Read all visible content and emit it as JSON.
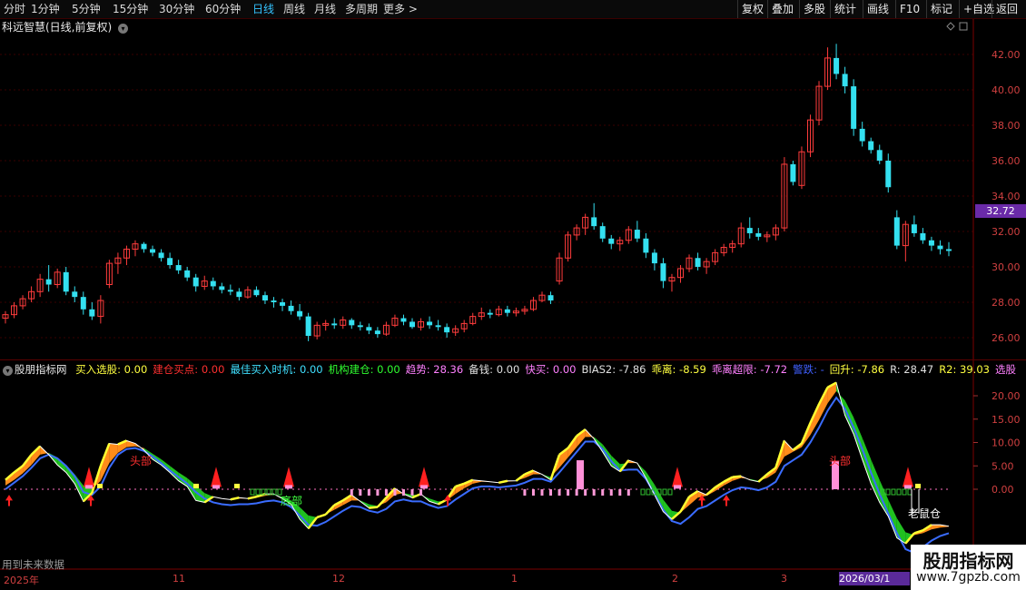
{
  "toolbar": {
    "periods": [
      "分时",
      "1分钟",
      "5分钟",
      "15分钟",
      "30分钟",
      "60分钟",
      "日线",
      "周线",
      "月线",
      "多周期",
      "更多 >"
    ],
    "active_period": "日线",
    "right_buttons": [
      "复权",
      "叠加",
      "多股",
      "统计",
      "画线",
      "F10",
      "标记",
      "+自选",
      "返回"
    ]
  },
  "chart_title": "科远智慧(日线,前复权)",
  "price_axis": {
    "ticks": [
      "42.00",
      "40.00",
      "38.00",
      "36.00",
      "34.00",
      "32.00",
      "30.00",
      "28.00",
      "26.00"
    ],
    "current": "32.72"
  },
  "indicator": {
    "name": "股朋指标网",
    "items": [
      {
        "label": "买入选股: 0.00",
        "color": "#ffff40"
      },
      {
        "label": "建仓买点: 0.00",
        "color": "#ff3030"
      },
      {
        "label": "最佳买入时机: 0.00",
        "color": "#40e0ff"
      },
      {
        "label": "机构建仓: 0.00",
        "color": "#30ff30"
      },
      {
        "label": "趋势: 28.36",
        "color": "#ff80ff"
      },
      {
        "label": "备钱: 0.00",
        "color": "#e0e0e0"
      },
      {
        "label": "快买: 0.00",
        "color": "#ff80ff"
      },
      {
        "label": "BIAS2: -7.86",
        "color": "#e0e0e0"
      },
      {
        "label": "乖离: -8.59",
        "color": "#ffff40"
      },
      {
        "label": "乖离超限: -7.72",
        "color": "#ff80ff"
      },
      {
        "label": "警跌: -",
        "color": "#4060ff"
      },
      {
        "label": "回升: -7.86",
        "color": "#ffff40"
      },
      {
        "label": "R: 28.47",
        "color": "#e0e0e0"
      },
      {
        "label": "R2: 39.03",
        "color": "#ffff40"
      },
      {
        "label": "选股",
        "color": "#ff80ff"
      }
    ],
    "axis": [
      "20.00",
      "15.00",
      "10.00",
      "5.00",
      "0.00"
    ],
    "labels": {
      "bottom": "底部",
      "top": "头部",
      "exit": "老鼠仓"
    }
  },
  "footer_note": "用到未来数据",
  "x_axis": [
    "2025年",
    "11",
    "12",
    "1",
    "2",
    "3"
  ],
  "cursor_date": "2026/03/1",
  "watermark": {
    "line1": "股朋指标网",
    "line2": "www.7gpzb.com"
  },
  "candles": [
    [
      27.1,
      27.5,
      26.8,
      27.3
    ],
    [
      27.3,
      28.0,
      27.1,
      27.8
    ],
    [
      27.8,
      28.4,
      27.6,
      28.2
    ],
    [
      28.2,
      28.9,
      28.0,
      28.6
    ],
    [
      28.6,
      29.6,
      28.3,
      29.3
    ],
    [
      29.3,
      30.1,
      28.6,
      29.0
    ],
    [
      29.0,
      29.9,
      28.8,
      29.7
    ],
    [
      29.7,
      30.0,
      28.4,
      28.6
    ],
    [
      28.6,
      28.9,
      28.0,
      28.3
    ],
    [
      28.3,
      28.6,
      27.3,
      27.6
    ],
    [
      27.6,
      28.0,
      27.0,
      27.2
    ],
    [
      27.2,
      28.4,
      26.8,
      28.1
    ],
    [
      29.0,
      30.4,
      28.8,
      30.2
    ],
    [
      30.2,
      30.8,
      29.6,
      30.5
    ],
    [
      30.5,
      31.2,
      30.1,
      31.0
    ],
    [
      31.0,
      31.5,
      30.6,
      31.3
    ],
    [
      31.3,
      31.4,
      30.8,
      31.0
    ],
    [
      31.0,
      31.2,
      30.6,
      30.8
    ],
    [
      30.8,
      31.0,
      30.3,
      30.5
    ],
    [
      30.5,
      30.8,
      29.9,
      30.1
    ],
    [
      30.1,
      30.4,
      29.6,
      29.8
    ],
    [
      29.8,
      30.0,
      29.2,
      29.4
    ],
    [
      29.4,
      29.6,
      28.6,
      28.9
    ],
    [
      28.9,
      29.5,
      28.7,
      29.2
    ],
    [
      29.2,
      29.4,
      28.7,
      28.9
    ],
    [
      28.9,
      29.1,
      28.5,
      28.7
    ],
    [
      28.7,
      29.0,
      28.4,
      28.6
    ],
    [
      28.6,
      28.8,
      28.1,
      28.3
    ],
    [
      28.3,
      28.9,
      28.2,
      28.7
    ],
    [
      28.7,
      28.9,
      28.3,
      28.4
    ],
    [
      28.4,
      28.6,
      27.9,
      28.1
    ],
    [
      28.1,
      28.3,
      27.7,
      28.0
    ],
    [
      28.0,
      28.2,
      27.5,
      27.8
    ],
    [
      27.8,
      28.1,
      27.3,
      27.5
    ],
    [
      27.5,
      27.9,
      27.0,
      27.2
    ],
    [
      27.2,
      27.4,
      25.8,
      26.1
    ],
    [
      26.1,
      26.9,
      25.9,
      26.7
    ],
    [
      26.7,
      27.0,
      26.4,
      26.8
    ],
    [
      26.8,
      27.1,
      26.5,
      26.7
    ],
    [
      26.7,
      27.2,
      26.5,
      27.0
    ],
    [
      27.0,
      27.1,
      26.5,
      26.7
    ],
    [
      26.7,
      26.9,
      26.4,
      26.6
    ],
    [
      26.6,
      26.8,
      26.2,
      26.4
    ],
    [
      26.4,
      26.6,
      26.0,
      26.2
    ],
    [
      26.2,
      26.9,
      26.1,
      26.7
    ],
    [
      26.7,
      27.3,
      26.6,
      27.1
    ],
    [
      27.1,
      27.3,
      26.7,
      26.9
    ],
    [
      26.9,
      27.1,
      26.5,
      26.6
    ],
    [
      26.6,
      27.1,
      26.4,
      26.9
    ],
    [
      26.9,
      27.2,
      26.5,
      26.7
    ],
    [
      26.7,
      27.0,
      26.4,
      26.6
    ],
    [
      26.6,
      26.8,
      26.0,
      26.3
    ],
    [
      26.3,
      26.7,
      26.1,
      26.5
    ],
    [
      26.5,
      27.0,
      26.3,
      26.8
    ],
    [
      26.8,
      27.4,
      26.7,
      27.2
    ],
    [
      27.2,
      27.7,
      27.0,
      27.4
    ],
    [
      27.4,
      27.6,
      27.1,
      27.3
    ],
    [
      27.3,
      27.8,
      27.2,
      27.6
    ],
    [
      27.6,
      27.8,
      27.2,
      27.4
    ],
    [
      27.4,
      27.7,
      27.2,
      27.5
    ],
    [
      27.5,
      27.8,
      27.3,
      27.6
    ],
    [
      27.6,
      28.3,
      27.5,
      28.1
    ],
    [
      28.1,
      28.6,
      28.0,
      28.4
    ],
    [
      28.4,
      28.6,
      27.9,
      28.1
    ],
    [
      29.2,
      30.8,
      29.0,
      30.5
    ],
    [
      30.5,
      32.0,
      30.3,
      31.8
    ],
    [
      31.8,
      32.4,
      31.5,
      32.2
    ],
    [
      32.2,
      33.0,
      31.8,
      32.8
    ],
    [
      32.8,
      33.6,
      32.1,
      32.3
    ],
    [
      32.3,
      32.5,
      31.4,
      31.6
    ],
    [
      31.6,
      31.8,
      31.0,
      31.3
    ],
    [
      31.3,
      31.7,
      30.9,
      31.5
    ],
    [
      31.5,
      32.3,
      31.3,
      32.1
    ],
    [
      32.1,
      32.6,
      31.4,
      31.6
    ],
    [
      31.6,
      31.9,
      30.5,
      30.8
    ],
    [
      30.8,
      31.0,
      29.8,
      30.2
    ],
    [
      30.2,
      30.5,
      28.8,
      29.2
    ],
    [
      29.2,
      29.6,
      28.6,
      29.4
    ],
    [
      29.4,
      30.1,
      29.1,
      29.9
    ],
    [
      29.9,
      30.7,
      29.7,
      30.5
    ],
    [
      30.5,
      30.8,
      29.8,
      30.0
    ],
    [
      30.0,
      30.5,
      29.6,
      30.3
    ],
    [
      30.3,
      31.0,
      30.1,
      30.8
    ],
    [
      30.8,
      31.3,
      30.6,
      31.1
    ],
    [
      31.1,
      31.5,
      30.8,
      31.3
    ],
    [
      31.3,
      32.5,
      31.1,
      32.2
    ],
    [
      32.2,
      32.8,
      31.6,
      31.9
    ],
    [
      31.9,
      32.2,
      31.5,
      31.7
    ],
    [
      31.7,
      32.0,
      31.4,
      31.8
    ],
    [
      31.8,
      32.4,
      31.5,
      32.2
    ],
    [
      32.2,
      36.2,
      32.0,
      35.8
    ],
    [
      35.8,
      36.0,
      34.6,
      34.8
    ],
    [
      34.6,
      36.8,
      34.4,
      36.5
    ],
    [
      36.5,
      38.6,
      36.2,
      38.3
    ],
    [
      38.3,
      40.5,
      38.0,
      40.2
    ],
    [
      40.2,
      42.4,
      40.0,
      41.8
    ],
    [
      41.8,
      42.6,
      40.6,
      40.9
    ],
    [
      40.9,
      41.3,
      39.8,
      40.2
    ],
    [
      40.2,
      40.6,
      37.4,
      37.8
    ],
    [
      37.8,
      38.2,
      36.8,
      37.1
    ],
    [
      37.1,
      37.3,
      36.4,
      36.6
    ],
    [
      36.6,
      36.9,
      35.8,
      36.0
    ],
    [
      36.0,
      36.4,
      34.2,
      34.5
    ],
    [
      32.8,
      33.2,
      31.0,
      31.2
    ],
    [
      31.2,
      32.6,
      30.3,
      32.4
    ],
    [
      32.4,
      32.9,
      31.7,
      31.9
    ],
    [
      31.9,
      32.2,
      31.3,
      31.5
    ],
    [
      31.5,
      31.7,
      30.9,
      31.2
    ],
    [
      31.2,
      31.5,
      30.7,
      31.0
    ],
    [
      31.0,
      31.4,
      30.6,
      30.9
    ]
  ],
  "indicator_series": {
    "main": [
      2,
      3.6,
      5,
      7.4,
      9.2,
      7.4,
      5.2,
      3.6,
      1.2,
      -2.6,
      -0.8,
      5,
      9.8,
      9.6,
      10.4,
      9.8,
      8.4,
      6.4,
      5.2,
      3.6,
      1.8,
      0.6,
      -2.4,
      -2.8,
      -1.6,
      -2,
      -2.2,
      -1.8,
      -2,
      -1.6,
      -1,
      -1,
      -2,
      -3.2,
      -6.4,
      -8.4,
      -6,
      -5.4,
      -3.4,
      -2.4,
      -1.2,
      -2.6,
      -4,
      -3.8,
      -1.8,
      0.2,
      -1,
      -1.8,
      -1,
      -2.6,
      -3.2,
      -2.2,
      0.6,
      1.2,
      2,
      1.8,
      1.6,
      1.4,
      1.8,
      1.8,
      3.2,
      4,
      3.2,
      2,
      7.4,
      8.8,
      11.4,
      12.8,
      10.8,
      8,
      5,
      3.8,
      6.2,
      5.6,
      2.4,
      -1.2,
      -4.8,
      -6.4,
      -4.8,
      -1.6,
      -0.4,
      -1.2,
      0.4,
      1.6,
      2.6,
      2.8,
      2,
      1.6,
      3.2,
      4.6,
      10.4,
      8.4,
      9.8,
      14.2,
      18.2,
      21.8,
      22.8,
      15.8,
      11.8,
      6.4,
      1.2,
      -2.8,
      -5.8,
      -10.4,
      -11.6,
      -9.4,
      -8.8,
      -7.6,
      -7.6,
      -7.9
    ],
    "fast": [
      0.8,
      2,
      3.4,
      5.2,
      7.4,
      7.8,
      6.8,
      5.2,
      3.2,
      0.8,
      0,
      1.8,
      5.6,
      7.8,
      9,
      9.2,
      8.8,
      7.6,
      6.4,
      5,
      3.6,
      2.4,
      0.8,
      -0.8,
      -1.6,
      -2,
      -2.2,
      -2,
      -2,
      -1.8,
      -1.4,
      -1.2,
      -1.6,
      -2.4,
      -3.8,
      -5.6,
      -6,
      -5.4,
      -4.4,
      -3.4,
      -2.4,
      -2.4,
      -3.2,
      -3.6,
      -2.8,
      -1.2,
      -0.8,
      -1.2,
      -1.2,
      -2,
      -2.6,
      -2.4,
      -1,
      0.2,
      1.2,
      1.6,
      1.6,
      1.4,
      1.6,
      1.8,
      2.4,
      3.2,
      3.2,
      2.6,
      4.6,
      6.8,
      9,
      11.2,
      11.2,
      9.6,
      7.2,
      5.4,
      5.6,
      5.6,
      3.8,
      1,
      -2.2,
      -4.6,
      -5,
      -3.4,
      -1.8,
      -1.4,
      -0.4,
      0.8,
      1.8,
      2.4,
      2.2,
      1.8,
      2.4,
      3.6,
      7,
      8,
      9,
      11.6,
      14.8,
      18.4,
      21,
      19,
      15.4,
      11,
      6.4,
      2,
      -2.2,
      -6.2,
      -9.2,
      -9.8,
      -9.4,
      -8.6,
      -8.2,
      -8
    ],
    "blue": [
      0,
      1.4,
      2.8,
      4.6,
      6.6,
      7.4,
      6.6,
      5,
      2.8,
      -0.6,
      -1.2,
      0.6,
      4.6,
      7.4,
      8.6,
      8.8,
      8.2,
      7,
      5.6,
      4,
      2.6,
      1.2,
      -0.6,
      -2,
      -2.8,
      -3.2,
      -3.4,
      -3.2,
      -3.2,
      -3,
      -2.6,
      -2.4,
      -2.8,
      -3.8,
      -5.6,
      -7.6,
      -7.8,
      -7,
      -5.8,
      -4.6,
      -3.6,
      -3.8,
      -4.6,
      -5,
      -4.2,
      -2.6,
      -2.2,
      -2.6,
      -2.6,
      -3.4,
      -4,
      -3.6,
      -2.2,
      -1,
      0.2,
      0.6,
      0.6,
      0.4,
      0.6,
      0.8,
      1.4,
      2.2,
      2.2,
      1.6,
      3.6,
      5.8,
      8,
      10.2,
      10.2,
      8.6,
      6,
      4,
      4.2,
      4.2,
      2.2,
      -1,
      -4.4,
      -6.8,
      -7.4,
      -6,
      -4.2,
      -3.6,
      -2.4,
      -1.2,
      -0.2,
      0.4,
      0.2,
      -0.2,
      0.4,
      1.6,
      5,
      6.2,
      7.4,
      10,
      13.2,
      16.8,
      19.6,
      17.2,
      13.2,
      8.6,
      3.6,
      -1,
      -5.2,
      -9.4,
      -12.8,
      -13.6,
      -12.4,
      -11,
      -10,
      -9.4
    ]
  }
}
